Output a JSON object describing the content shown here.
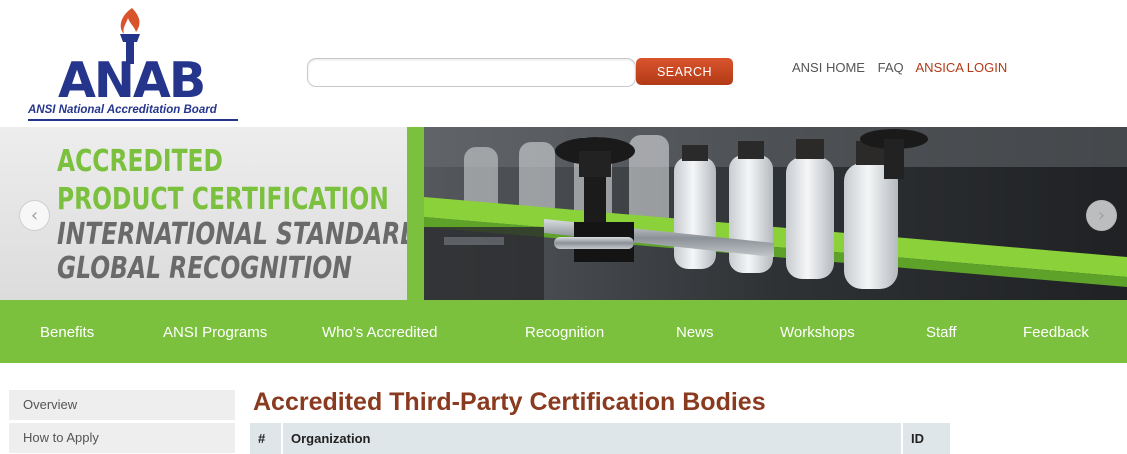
{
  "brand": {
    "logo_text": "ANAB",
    "tagline_bold": "ANSI",
    "tagline_rest": " National Accreditation Board",
    "color_primary": "#26358c",
    "color_torch": "#d9542c"
  },
  "search": {
    "placeholder": "",
    "value": "",
    "button_label": "SEARCH"
  },
  "top_links": [
    {
      "label": "ANSI HOME"
    },
    {
      "label": "FAQ"
    },
    {
      "label": "ANSICA LOGIN"
    }
  ],
  "banner": {
    "line1": "ACCREDITED",
    "line2": "PRODUCT CERTIFICATION",
    "line3": "INTERNATIONAL STANDARDS",
    "line4": "GLOBAL RECOGNITION",
    "prev_icon": "chevron-left-icon",
    "next_icon": "chevron-right-icon",
    "accent_color": "#7bc13e"
  },
  "nav": {
    "items": [
      {
        "label": "Benefits"
      },
      {
        "label": "ANSI Programs"
      },
      {
        "label": "Who's Accredited"
      },
      {
        "label": "Recognition"
      },
      {
        "label": "News"
      },
      {
        "label": "Workshops"
      },
      {
        "label": "Staff"
      },
      {
        "label": "Feedback"
      }
    ]
  },
  "sidebar": {
    "items": [
      {
        "label": "Overview"
      },
      {
        "label": "How to Apply"
      }
    ]
  },
  "main": {
    "title": "Accredited Third-Party Certification Bodies",
    "title_color": "#8a3a1e",
    "table": {
      "columns": [
        "#",
        "Organization",
        "ID"
      ]
    }
  }
}
